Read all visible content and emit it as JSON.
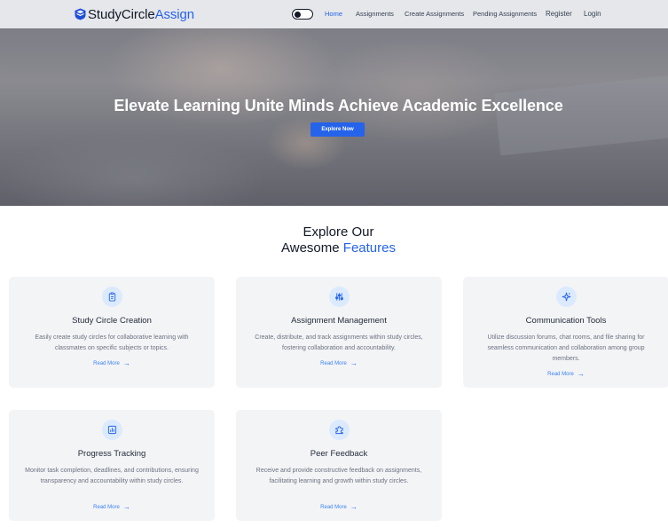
{
  "nav": {
    "brand_study": "StudyCircle",
    "brand_assign": "Assign",
    "links": [
      "Home",
      "Assignments",
      "Create Assignments",
      "Pending Assignments",
      "Register",
      "Login"
    ]
  },
  "hero": {
    "title": "Elevate Learning Unite Minds Achieve Academic Excellence",
    "button": "Explore Now"
  },
  "features": {
    "heading_line1": "Explore Our",
    "heading_line2_plain": "Awesome",
    "heading_line2_accent": "Features",
    "cards": [
      {
        "icon": "clipboard-icon",
        "title": "Study Circle Creation",
        "description": "Easily create study circles for collaborative learning with classmates on specific subjects or topics.",
        "link": "Read More"
      },
      {
        "icon": "sliders-icon",
        "title": "Assignment Management",
        "description": "Create, distribute, and track assignments within study circles, fostering collaboration and accountability.",
        "link": "Read More"
      },
      {
        "icon": "sparkle-icon",
        "title": "Communication Tools",
        "description": "Utilize discussion forums, chat rooms, and file sharing for seamless communication and collaboration among group members.",
        "link": "Read More"
      },
      {
        "icon": "bar-chart-icon",
        "title": "Progress Tracking",
        "description": "Monitor task completion, deadlines, and contributions, ensuring transparency and accountability within study circles.",
        "link": "Read More"
      },
      {
        "icon": "puzzle-icon",
        "title": "Peer Feedback",
        "description": "Receive and provide constructive feedback on assignments, facilitating learning and growth within study circles.",
        "link": "Read More"
      }
    ]
  },
  "colors": {
    "accent": "#2563eb",
    "nav_bg": "#e5e7eb",
    "card_bg": "#f3f4f6",
    "icon_bg": "#dbeafe"
  }
}
